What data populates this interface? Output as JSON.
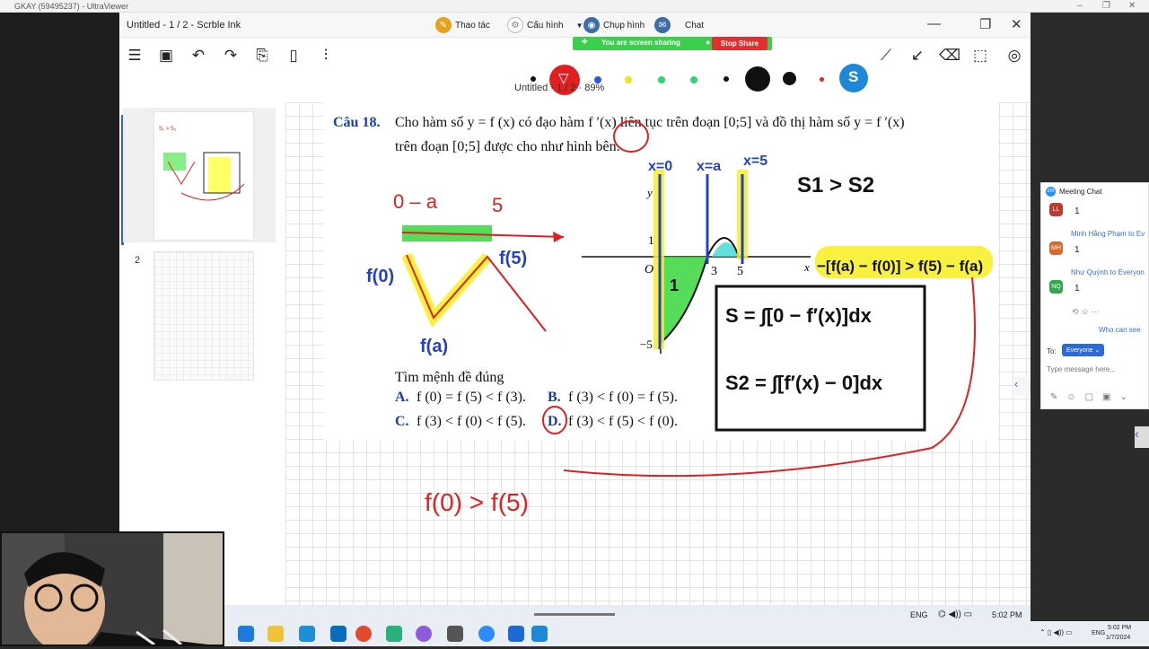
{
  "viewer": {
    "title": "GKAY (59495237) - UltraViewer",
    "controls": [
      "–",
      "❐",
      "✕"
    ]
  },
  "app": {
    "title": "Untitled - 1 / 2 - Scrble Ink",
    "menu": [
      {
        "label": "Thao tác",
        "icon": "pencil-icon"
      },
      {
        "label": "Cấu hình",
        "icon": "gear-icon"
      },
      {
        "label": "Chụp hình",
        "icon": "camera-icon"
      },
      {
        "label": "Chat",
        "icon": "chat-icon"
      }
    ],
    "window_controls": [
      "—",
      "❐",
      "✕"
    ],
    "doc_info": "Untitled  ·  1 / 2  ·  89%"
  },
  "share": {
    "message": "You are screen sharing",
    "stop": "Stop Share"
  },
  "thumbs": [
    {
      "num": "1"
    },
    {
      "num": "2"
    }
  ],
  "question": {
    "label": "Câu 18.",
    "line1": "Cho hàm số  y = f (x)  có đạo hàm  f ′(x)  liên tục trên đoạn  [0;5]  và đồ thị hàm số  y = f ′(x)",
    "line2": "trên đoạn  [0;5]  được cho như hình bên.",
    "prompt": "Tìm mệnh đề đúng",
    "optA": "A.",
    "optA_text": "f (0) = f (5) < f (3).",
    "optB": "B.",
    "optB_text": "f (3) < f (0) = f (5).",
    "optC": "C.",
    "optC_text": "f (3) < f (0) < f (5).",
    "optD": "D.",
    "optD_text": "f (3) < f (5) < f (0).",
    "axis": {
      "o": "O",
      "three": "3",
      "five": "5",
      "one": "1",
      "neg5": "−5",
      "y": "y",
      "x": "x"
    }
  },
  "ink": {
    "s1s2": "S1 > S2",
    "s_top": "S = ∫[0 − f′(x)]dx",
    "s2": "S2 = ∫[f′(x) − 0]dx",
    "f0f5": "f(0) > f(5)",
    "fa": "f(a)",
    "f0": "f(0)",
    "f5": "f(5)",
    "x0": "x=0",
    "xa": "x=a",
    "x5": "x=5",
    "ineq": "−[f(a) − f(0)] > f(5) − f(a)",
    "num_one": "1"
  },
  "chat": {
    "header": "Meeting Chat",
    "messages": [
      {
        "initials": "LL",
        "color": "#c0392b",
        "name": "",
        "text": "1"
      },
      {
        "initials": "MH",
        "color": "#d86a2b",
        "name": "Minh Hằng Phạm to Ev",
        "text": "1"
      },
      {
        "initials": "NQ",
        "color": "#2ea84a",
        "name": "Như Quỳnh to Everyon",
        "text": "1"
      }
    ],
    "who": "Who can see",
    "to": "To:",
    "recipient": "Everyone ⌄",
    "placeholder": "Type message here..."
  },
  "taskbar": {
    "lang": "ENG",
    "time": "5:02 PM"
  },
  "wtaskbar": {
    "lang": "ENG",
    "time": "5:02 PM",
    "date": "1/7/2024"
  }
}
